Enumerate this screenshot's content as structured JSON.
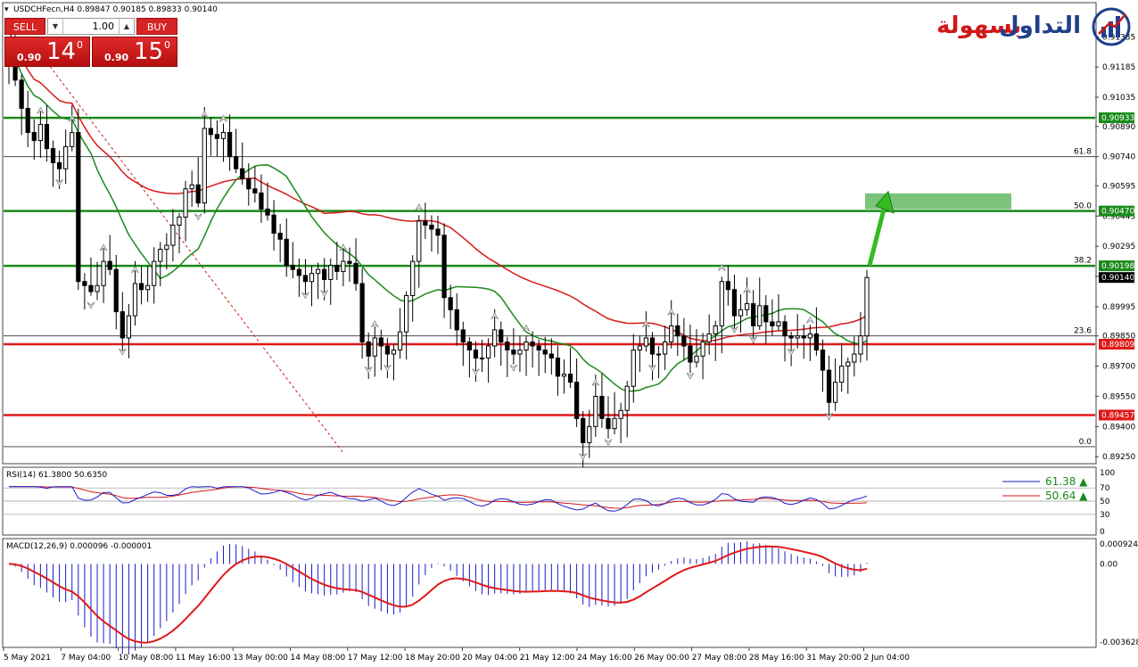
{
  "main_panel": {
    "header": "USDCHFecn,H4  0.89847 0.90185 0.89833 0.90140",
    "price_ticks": [
      "0.91335",
      "0.91185",
      "0.91035",
      "0.90890",
      "0.90740",
      "0.90595",
      "0.90445",
      "0.90295",
      "0.90145",
      "0.89995",
      "0.89850",
      "0.89700",
      "0.89550",
      "0.89400",
      "0.89250"
    ],
    "fib_labels": [
      "61.8",
      "50.0",
      "38.2",
      "23.6",
      "0.0"
    ],
    "level_tags": {
      "green_top": "0.90933",
      "green_mid": "0.90470",
      "green_low": "0.90198",
      "current": "0.90140",
      "red_high": "0.89809",
      "red_low": "0.89457"
    }
  },
  "trade_panel": {
    "sell_label": "SELL",
    "buy_label": "BUY",
    "lot_value": "1.00",
    "sell_small": "0.90",
    "sell_big": "14",
    "sell_sup": "0",
    "buy_small": "0.90",
    "buy_big": "15",
    "buy_sup": "0"
  },
  "logo": {
    "word_1": "التداول",
    "word_2": "بسهولة"
  },
  "rsi_panel": {
    "header": "RSI(14) 61.3800 50.6350",
    "legend_1": "61.38 ▲",
    "legend_2": "50.64 ▲",
    "ticks": [
      "100",
      "70",
      "50",
      "30",
      "0"
    ]
  },
  "macd_panel": {
    "header": "MACD(12,26,9) 0.000096 -0.000001",
    "ticks": [
      "0.000924",
      "0.00",
      "-0.003628"
    ]
  },
  "time_labels": [
    "5 May 2021",
    "7 May 04:00",
    "10 May 08:00",
    "11 May 16:00",
    "13 May 00:00",
    "14 May 08:00",
    "17 May 12:00",
    "18 May 20:00",
    "20 May 04:00",
    "21 May 12:00",
    "24 May 16:00",
    "26 May 00:00",
    "27 May 08:00",
    "28 May 16:00",
    "31 May 20:00",
    "2 Jun 04:00"
  ],
  "colors": {
    "green_line": "#1a8a1a",
    "red_line": "#e01818",
    "ma_fast": "#1a8a1a",
    "ma_slow": "#d81818",
    "fib": "#333333",
    "tag_green": "#1a8a1a",
    "tag_red": "#e01818",
    "target_zone": "#7cc47c",
    "arrow": "#33bb22",
    "rsi_main": "#1a1acc",
    "rsi_signal": "#d81818",
    "macd_hist": "#1a1acc",
    "macd_signal": "#e01818"
  },
  "chart_data": {
    "type": "candlestick",
    "symbol": "USDCHFecn",
    "timeframe": "H4",
    "ohlc_last": {
      "open": 0.89847,
      "high": 0.90185,
      "low": 0.89833,
      "close": 0.9014
    },
    "ylim": [
      0.8922,
      0.915
    ],
    "horizontal_levels": [
      {
        "value": 0.90933,
        "color": "green"
      },
      {
        "value": 0.9047,
        "color": "green"
      },
      {
        "value": 0.90198,
        "color": "green"
      },
      {
        "value": 0.89809,
        "color": "red"
      },
      {
        "value": 0.89457,
        "color": "red"
      }
    ],
    "fibonacci": [
      {
        "level": "61.8",
        "price": 0.9074
      },
      {
        "level": "50.0",
        "price": 0.9047
      },
      {
        "level": "38.2",
        "price": 0.902
      },
      {
        "level": "23.6",
        "price": 0.8985
      },
      {
        "level": "0.0",
        "price": 0.893
      }
    ],
    "target_zone": {
      "low": 0.9047,
      "high": 0.9054
    },
    "closes": [
      0.9124,
      0.9112,
      0.9098,
      0.9086,
      0.9082,
      0.909,
      0.9078,
      0.9071,
      0.9068,
      0.9079,
      0.9086,
      0.9012,
      0.901,
      0.9007,
      0.901,
      0.9022,
      0.9018,
      0.8997,
      0.8984,
      0.8995,
      0.9011,
      0.9008,
      0.901,
      0.9022,
      0.9028,
      0.903,
      0.904,
      0.9044,
      0.9058,
      0.906,
      0.9051,
      0.9088,
      0.9085,
      0.9083,
      0.9086,
      0.9074,
      0.9068,
      0.9063,
      0.9058,
      0.9056,
      0.9048,
      0.9045,
      0.9036,
      0.9033,
      0.902,
      0.9018,
      0.9015,
      0.9012,
      0.9016,
      0.9018,
      0.9013,
      0.902,
      0.9017,
      0.9022,
      0.9021,
      0.9011,
      0.8982,
      0.8975,
      0.8984,
      0.898,
      0.8976,
      0.8978,
      0.8987,
      0.9005,
      0.9022,
      0.9042,
      0.904,
      0.9038,
      0.9035,
      0.9004,
      0.8998,
      0.8988,
      0.8982,
      0.8978,
      0.8974,
      0.8974,
      0.898,
      0.8988,
      0.8982,
      0.8978,
      0.8976,
      0.8978,
      0.8982,
      0.898,
      0.8978,
      0.8976,
      0.8974,
      0.8965,
      0.8966,
      0.8962,
      0.8944,
      0.8932,
      0.894,
      0.8955,
      0.8944,
      0.8939,
      0.8944,
      0.8948,
      0.896,
      0.8978,
      0.898,
      0.8984,
      0.8976,
      0.8976,
      0.8982,
      0.899,
      0.8985,
      0.898,
      0.8972,
      0.8975,
      0.8982,
      0.8986,
      0.899,
      0.9012,
      0.9008,
      0.8995,
      0.8998,
      0.9001,
      0.899,
      0.9,
      0.8992,
      0.899,
      0.8992,
      0.8985,
      0.8984,
      0.8985,
      0.8984,
      0.8986,
      0.8978,
      0.8968,
      0.8952,
      0.8962,
      0.897,
      0.8972,
      0.8976,
      0.8985,
      0.9014
    ]
  }
}
